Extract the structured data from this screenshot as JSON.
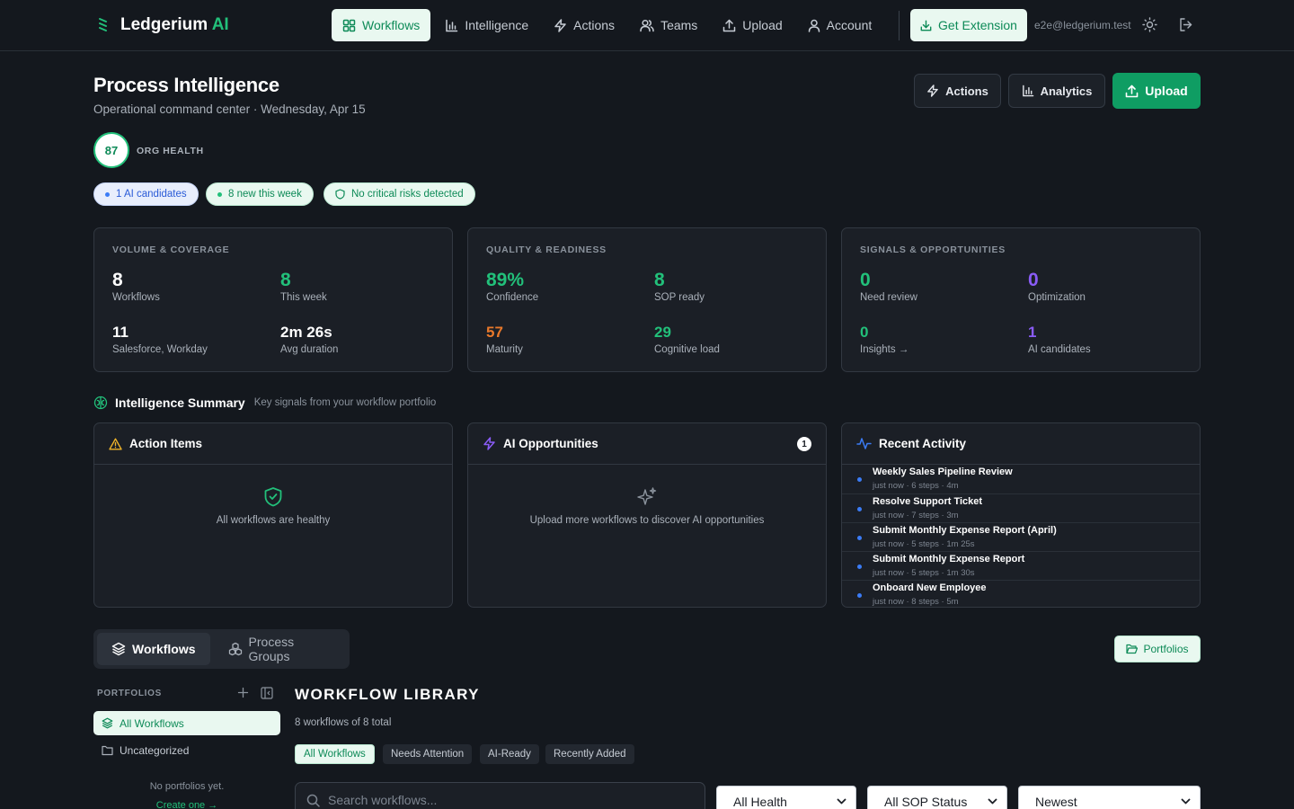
{
  "app": {
    "name": "Ledgerium",
    "name_suffix": "AI"
  },
  "nav": {
    "items": [
      {
        "label": "Workflows",
        "icon": "grid-icon"
      },
      {
        "label": "Intelligence",
        "icon": "bar-chart-icon"
      },
      {
        "label": "Actions",
        "icon": "bolt-icon"
      },
      {
        "label": "Teams",
        "icon": "users-icon"
      },
      {
        "label": "Upload",
        "icon": "upload-icon"
      },
      {
        "label": "Account",
        "icon": "user-icon"
      }
    ],
    "active": "Workflows",
    "extension_button": "Get Extension",
    "user_email": "e2e@ledgerium.test"
  },
  "header": {
    "title": "Process Intelligence",
    "subtitle": "Operational command center · Wednesday, Apr 15",
    "actions_button": "Actions",
    "analytics_button": "Analytics",
    "upload_button": "Upload"
  },
  "health": {
    "score": "87",
    "label": "ORG HEALTH"
  },
  "pills": [
    {
      "text": "1 AI candidates"
    },
    {
      "text": "8 new this week"
    },
    {
      "text": "No critical risks detected"
    }
  ],
  "metric_cards": [
    {
      "title": "VOLUME & COVERAGE",
      "metrics": [
        {
          "value": "8",
          "label": "Workflows"
        },
        {
          "value": "8",
          "label": "This week"
        },
        {
          "value": "11",
          "label": "Salesforce, Workday"
        },
        {
          "value": "2m 26s",
          "label": "Avg duration"
        }
      ]
    },
    {
      "title": "QUALITY & READINESS",
      "metrics": [
        {
          "value": "89%",
          "label": "Confidence"
        },
        {
          "value": "8",
          "label": "SOP ready"
        },
        {
          "value": "57",
          "label": "Maturity"
        },
        {
          "value": "29",
          "label": "Cognitive load"
        }
      ]
    },
    {
      "title": "SIGNALS & OPPORTUNITIES",
      "metrics": [
        {
          "value": "0",
          "label": "Need review"
        },
        {
          "value": "0",
          "label": "Optimization"
        },
        {
          "value": "0",
          "label": "Insights →"
        },
        {
          "value": "1",
          "label": "AI candidates"
        }
      ]
    }
  ],
  "summary": {
    "title": "Intelligence Summary",
    "subtitle": "Key signals from your workflow portfolio",
    "action_items": {
      "title": "Action Items",
      "empty_text": "All workflows are healthy"
    },
    "ai_opportunities": {
      "title": "AI Opportunities",
      "count": "1",
      "empty_text": "Upload more workflows to discover AI opportunities"
    },
    "recent_activity": {
      "title": "Recent Activity",
      "items": [
        {
          "title": "Weekly Sales Pipeline Review",
          "meta": "just now · 6 steps · 4m"
        },
        {
          "title": "Resolve Support Ticket",
          "meta": "just now · 7 steps · 3m"
        },
        {
          "title": "Submit Monthly Expense Report (April)",
          "meta": "just now · 5 steps · 1m 25s"
        },
        {
          "title": "Submit Monthly Expense Report",
          "meta": "just now · 5 steps · 1m 30s"
        },
        {
          "title": "Onboard New Employee",
          "meta": "just now · 8 steps · 5m"
        }
      ]
    }
  },
  "tabs": {
    "workflows": "Workflows",
    "process_groups": "Process Groups",
    "portfolios_button": "Portfolios"
  },
  "sidebar": {
    "label": "PORTFOLIOS",
    "items": [
      {
        "label": "All Workflows"
      },
      {
        "label": "Uncategorized"
      }
    ],
    "empty_text": "No portfolios yet.",
    "create_link": "Create one →"
  },
  "library": {
    "title": "WORKFLOW LIBRARY",
    "count": "8 workflows of 8 total",
    "filters": [
      "All Workflows",
      "Needs Attention",
      "AI-Ready",
      "Recently Added"
    ],
    "search_placeholder": "Search workflows...",
    "health_select": "All Health",
    "sop_select": "All SOP Status",
    "sort_select": "Newest"
  },
  "colors": {
    "accent": "#22c07a",
    "accent_dark": "#0d8a57",
    "background": "#14181e",
    "card": "#1b1f26",
    "orange": "#e8782a",
    "purple": "#8a5cf6",
    "blue": "#3b7cf6",
    "amber": "#f0b429"
  }
}
